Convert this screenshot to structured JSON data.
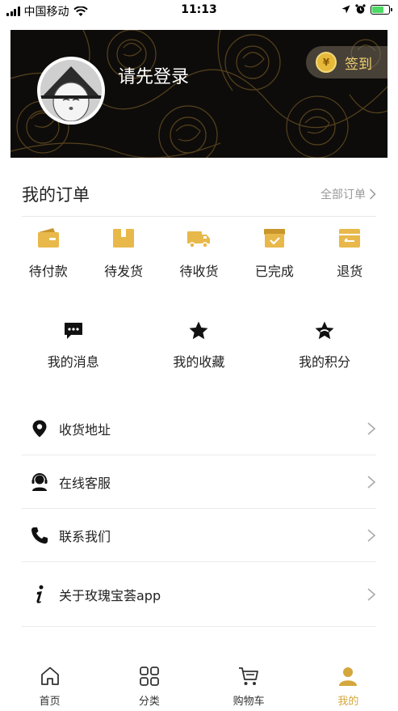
{
  "status_bar": {
    "carrier": "中国移动",
    "time": "11:13"
  },
  "header": {
    "login_prompt": "请先登录",
    "signin_label": "签到",
    "coin_symbol": "¥",
    "accent_color": "#e6b93a"
  },
  "orders": {
    "title": "我的订单",
    "all_label": "全部订单",
    "items": [
      {
        "label": "待付款",
        "icon": "wallet-icon"
      },
      {
        "label": "待发货",
        "icon": "package-icon"
      },
      {
        "label": "待收货",
        "icon": "truck-icon"
      },
      {
        "label": "已完成",
        "icon": "completed-box-icon"
      },
      {
        "label": "退货",
        "icon": "return-icon"
      }
    ]
  },
  "functions": {
    "items": [
      {
        "label": "我的消息",
        "icon": "message-icon"
      },
      {
        "label": "我的收藏",
        "icon": "star-icon"
      },
      {
        "label": "我的积分",
        "icon": "points-star-icon"
      }
    ]
  },
  "menu": {
    "items": [
      {
        "label": "收货地址",
        "icon": "location-pin-icon"
      },
      {
        "label": "在线客服",
        "icon": "customer-service-icon"
      },
      {
        "label": "联系我们",
        "icon": "phone-icon"
      },
      {
        "label": "关于玫瑰宝荟app",
        "icon": "info-icon"
      }
    ]
  },
  "tab_bar": {
    "items": [
      {
        "label": "首页",
        "icon": "home-icon",
        "active": false
      },
      {
        "label": "分类",
        "icon": "category-grid-icon",
        "active": false
      },
      {
        "label": "购物车",
        "icon": "cart-icon",
        "active": false
      },
      {
        "label": "我的",
        "icon": "profile-icon",
        "active": true
      }
    ],
    "active_color": "#d4a73d"
  }
}
